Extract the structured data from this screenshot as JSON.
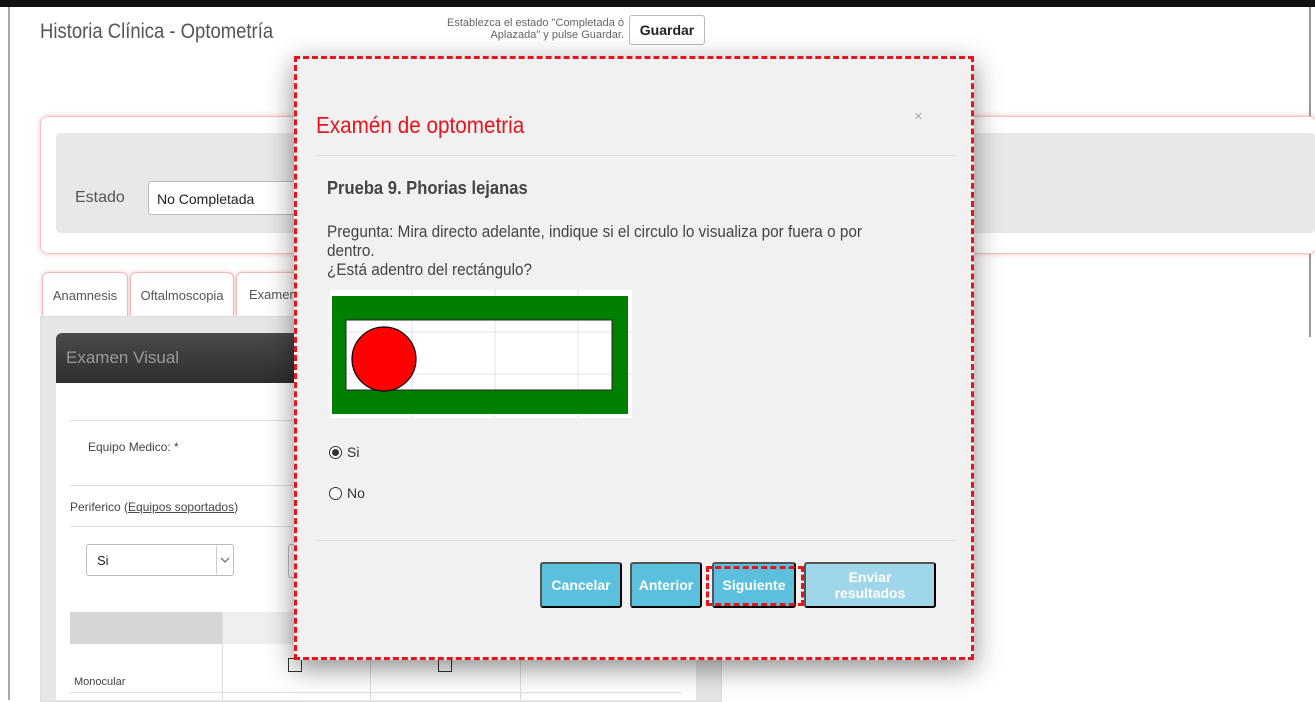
{
  "page": {
    "title": "Historia Clínica - Optometría",
    "hint_line1": "Establezca el estado \"Completada ó",
    "hint_line2": "Aplazada\" y pulse Guardar.",
    "save_label": "Guardar"
  },
  "estado": {
    "label": "Estado",
    "value": "No Completada"
  },
  "tabs": [
    {
      "label": "Anamnesis"
    },
    {
      "label": "Oftalmoscopia"
    },
    {
      "label": "Examen"
    }
  ],
  "examen_visual": {
    "header": "Examen Visual",
    "equipo_label": "Equipo Medico: *",
    "periferico_label": "Periferico (",
    "periferico_link": "Equipos soportados",
    "periferico_close": ")",
    "periferico_value": "Si",
    "row_label": "Monocular"
  },
  "modal": {
    "title": "Examén de optometria",
    "close_glyph": "×",
    "test_title": "Prueba 9. Phorias lejanas",
    "question_line1": "Pregunta: Mira directo adelante, indique si el circulo lo visualiza por fuera o por dentro.",
    "question_line2": "¿Está adentro del rectángulo?",
    "options": [
      {
        "label": "Si",
        "checked": true
      },
      {
        "label": "No",
        "checked": false
      }
    ],
    "buttons": {
      "cancel": "Cancelar",
      "previous": "Anterior",
      "next": "Siguiente",
      "send": "Enviar resultados"
    }
  },
  "colors": {
    "accent_red": "#e8141c",
    "button_info": "#5bc0de",
    "test_green": "#008000",
    "test_circle": "#ff0000"
  },
  "icons": {
    "close": "close-icon",
    "dropdown": "chevron-down-icon"
  }
}
